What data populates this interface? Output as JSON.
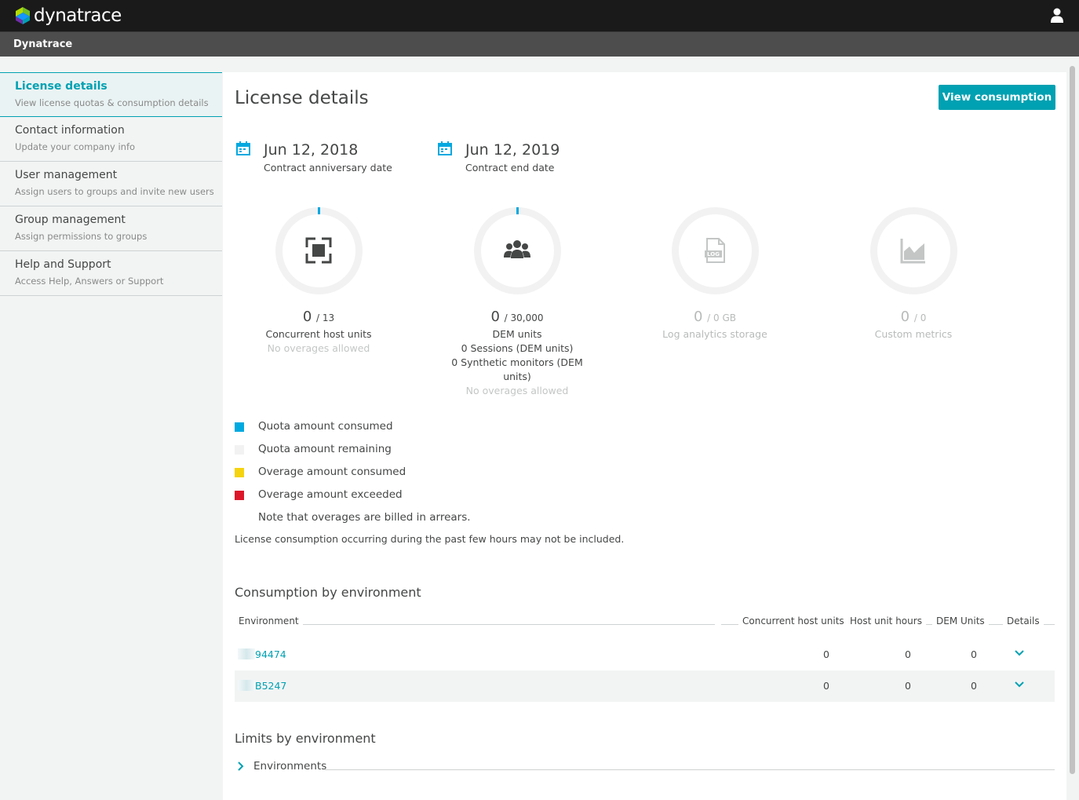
{
  "topbar": {
    "brand": "dynatrace",
    "user_icon": "user-icon"
  },
  "subbar": {
    "title": "Dynatrace"
  },
  "sidebar": {
    "items": [
      {
        "label": "License details",
        "desc": "View license quotas & consumption details",
        "active": true
      },
      {
        "label": "Contact information",
        "desc": "Update your company info"
      },
      {
        "label": "User management",
        "desc": "Assign users to groups and invite new users"
      },
      {
        "label": "Group management",
        "desc": "Assign permissions to groups"
      },
      {
        "label": "Help and Support",
        "desc": "Access Help, Answers or Support"
      }
    ]
  },
  "main": {
    "title": "License details",
    "view_consumption_label": "View consumption",
    "dates": [
      {
        "value": "Jun 12, 2018",
        "label": "Contract anniversary date",
        "icon": "calendar-icon"
      },
      {
        "value": "Jun 12, 2019",
        "label": "Contract end date",
        "icon": "calendar-icon"
      }
    ],
    "gauges": [
      {
        "used": "0",
        "cap": "/ 13",
        "label": "Concurrent host units",
        "note": "No overages allowed",
        "icon": "host-units-icon",
        "consumed_fraction": 0.0
      },
      {
        "used": "0",
        "cap": "/ 30,000",
        "label": "DEM units",
        "sessions": "0 Sessions (DEM units)",
        "synthetic": "0 Synthetic monitors (DEM units)",
        "note": "No overages allowed",
        "icon": "users-group-icon",
        "consumed_fraction": 0.0
      },
      {
        "used": "0",
        "cap": "/ 0 GB",
        "label": "Log analytics storage",
        "icon": "log-file-icon",
        "disabled": true
      },
      {
        "used": "0",
        "cap": "/ 0",
        "label": "Custom metrics",
        "icon": "area-chart-icon",
        "disabled": true
      }
    ],
    "legend": [
      {
        "label": "Quota amount consumed",
        "color": "#00a9e0"
      },
      {
        "label": "Quota amount remaining",
        "color": "#f2f2f2"
      },
      {
        "label": "Overage amount consumed",
        "color": "#f5d30f"
      },
      {
        "label": "Overage amount exceeded",
        "color": "#dc172a"
      }
    ],
    "legend_note": "Note that overages are billed in arrears.",
    "consumption_note": "License consumption occurring during the past few hours may not be included.",
    "consumption_section": {
      "title": "Consumption by environment",
      "columns": [
        "Environment",
        "Concurrent host units",
        "Host unit hours",
        "DEM Units",
        "Details"
      ],
      "rows": [
        {
          "environment": "94474",
          "host_units": "0",
          "host_hours": "0",
          "dem_units": "0"
        },
        {
          "environment": "B5247",
          "host_units": "0",
          "host_hours": "0",
          "dem_units": "0"
        }
      ]
    },
    "limits_section": {
      "title": "Limits by environment",
      "environments_label": "Environments"
    }
  },
  "colors": {
    "accent": "#00a1b2",
    "consumed": "#00a9e0",
    "topbar": "#1a1a1a"
  }
}
